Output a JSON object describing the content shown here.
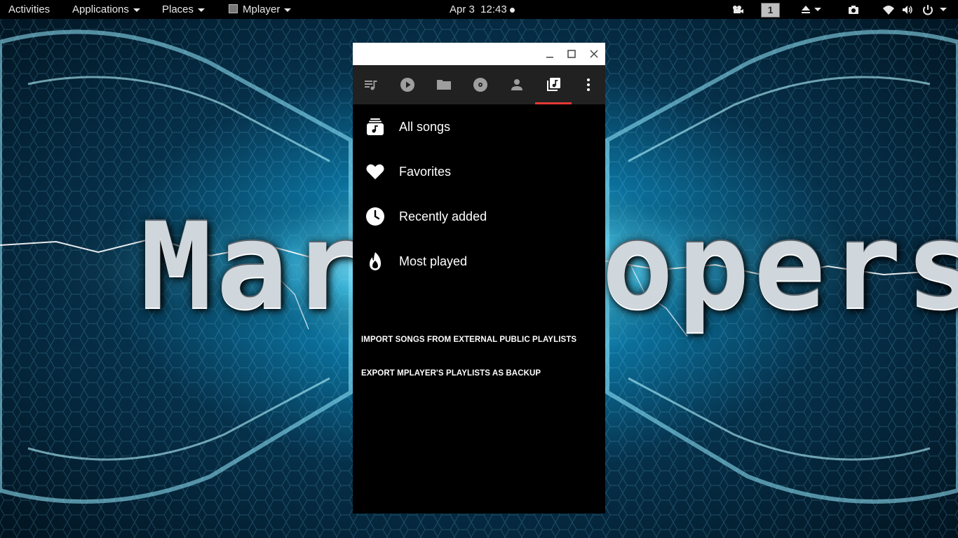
{
  "topbar": {
    "activities": "Activities",
    "applications": "Applications",
    "places": "Places",
    "app_name": "Mplayer",
    "clock": "Apr 3  12:43",
    "workspace": "1",
    "icons": [
      "video-camera-icon",
      "eject-icon",
      "screenshot-icon",
      "wifi-icon",
      "volume-icon",
      "power-icon"
    ]
  },
  "wallpaper": {
    "text_left": "Mart",
    "text_right": "opers"
  },
  "window": {
    "tabs": [
      {
        "icon": "queue-music-icon"
      },
      {
        "icon": "play-circle-icon"
      },
      {
        "icon": "folder-icon"
      },
      {
        "icon": "album-icon"
      },
      {
        "icon": "artist-icon"
      },
      {
        "icon": "playlist-library-icon",
        "selected": true
      },
      {
        "icon": "more-vert-icon"
      }
    ],
    "playlists": [
      {
        "label": "All songs",
        "icon": "all-songs-icon"
      },
      {
        "label": "Favorites",
        "icon": "heart-icon"
      },
      {
        "label": "Recently added",
        "icon": "clock-icon"
      },
      {
        "label": "Most played",
        "icon": "flame-icon"
      }
    ],
    "actions": [
      "IMPORT SONGS FROM EXTERNAL PUBLIC PLAYLISTS",
      "EXPORT MPLAYER'S PLAYLISTS AS BACKUP"
    ]
  },
  "colors": {
    "accent": "#e53935",
    "tabbar": "#212121",
    "tab_icon": "#9e9e9e",
    "content_bg": "#000000"
  }
}
